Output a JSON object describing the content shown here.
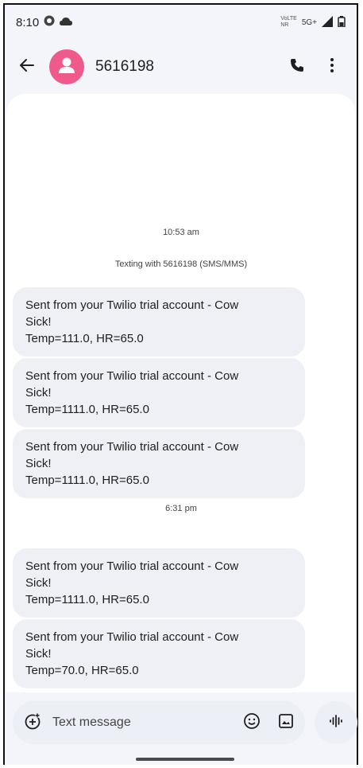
{
  "status_bar": {
    "time": "8:10",
    "network_line1": "VoLTE",
    "network_line2": "NR",
    "network_type": "5G+"
  },
  "header": {
    "contact_name": "5616198",
    "back_icon": "arrow-left-icon",
    "call_icon": "phone-icon",
    "menu_icon": "more-vert-icon",
    "avatar_color": "#ef5a8a"
  },
  "conversation": {
    "timestamp_1": "10:53 am",
    "info_text": "Texting with 5616198 (SMS/MMS)",
    "timestamp_2": "6:31 pm",
    "messages": [
      {
        "line1": "Sent from your Twilio trial account - Cow",
        "line2": "Sick!",
        "line3": "Temp=111.0, HR=65.0"
      },
      {
        "line1": "Sent from your Twilio trial account - Cow",
        "line2": "Sick!",
        "line3": "Temp=1111.0, HR=65.0"
      },
      {
        "line1": "Sent from your Twilio trial account - Cow",
        "line2": "Sick!",
        "line3": "Temp=1111.0, HR=65.0"
      },
      {
        "line1": "Sent from your Twilio trial account - Cow",
        "line2": "Sick!",
        "line3": "Temp=1111.0, HR=65.0"
      },
      {
        "line1": "Sent from your Twilio trial account - Cow",
        "line2": "Sick!",
        "line3": "Temp=70.0, HR=65.0"
      }
    ]
  },
  "composer": {
    "placeholder": "Text message",
    "add_icon": "add-circle-icon",
    "emoji_icon": "emoji-icon",
    "gallery_icon": "image-icon",
    "voice_icon": "voice-waveform-icon"
  }
}
